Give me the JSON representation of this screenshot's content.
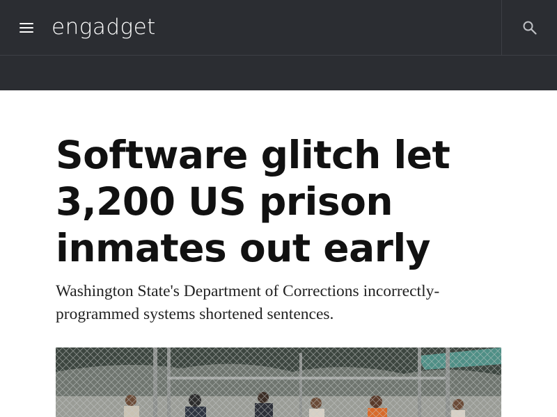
{
  "header": {
    "brand": "engadget",
    "menu_icon": "hamburger-menu-icon",
    "search_icon": "search-icon",
    "background_color": "#2b2d32"
  },
  "article": {
    "headline": "Software glitch let 3,200 US prison inmates out early",
    "dek": "Washington State's Department of Corrections incorrectly-programmed systems shortened sentences."
  },
  "hero_image": {
    "subject": "prison-yard-photo"
  }
}
